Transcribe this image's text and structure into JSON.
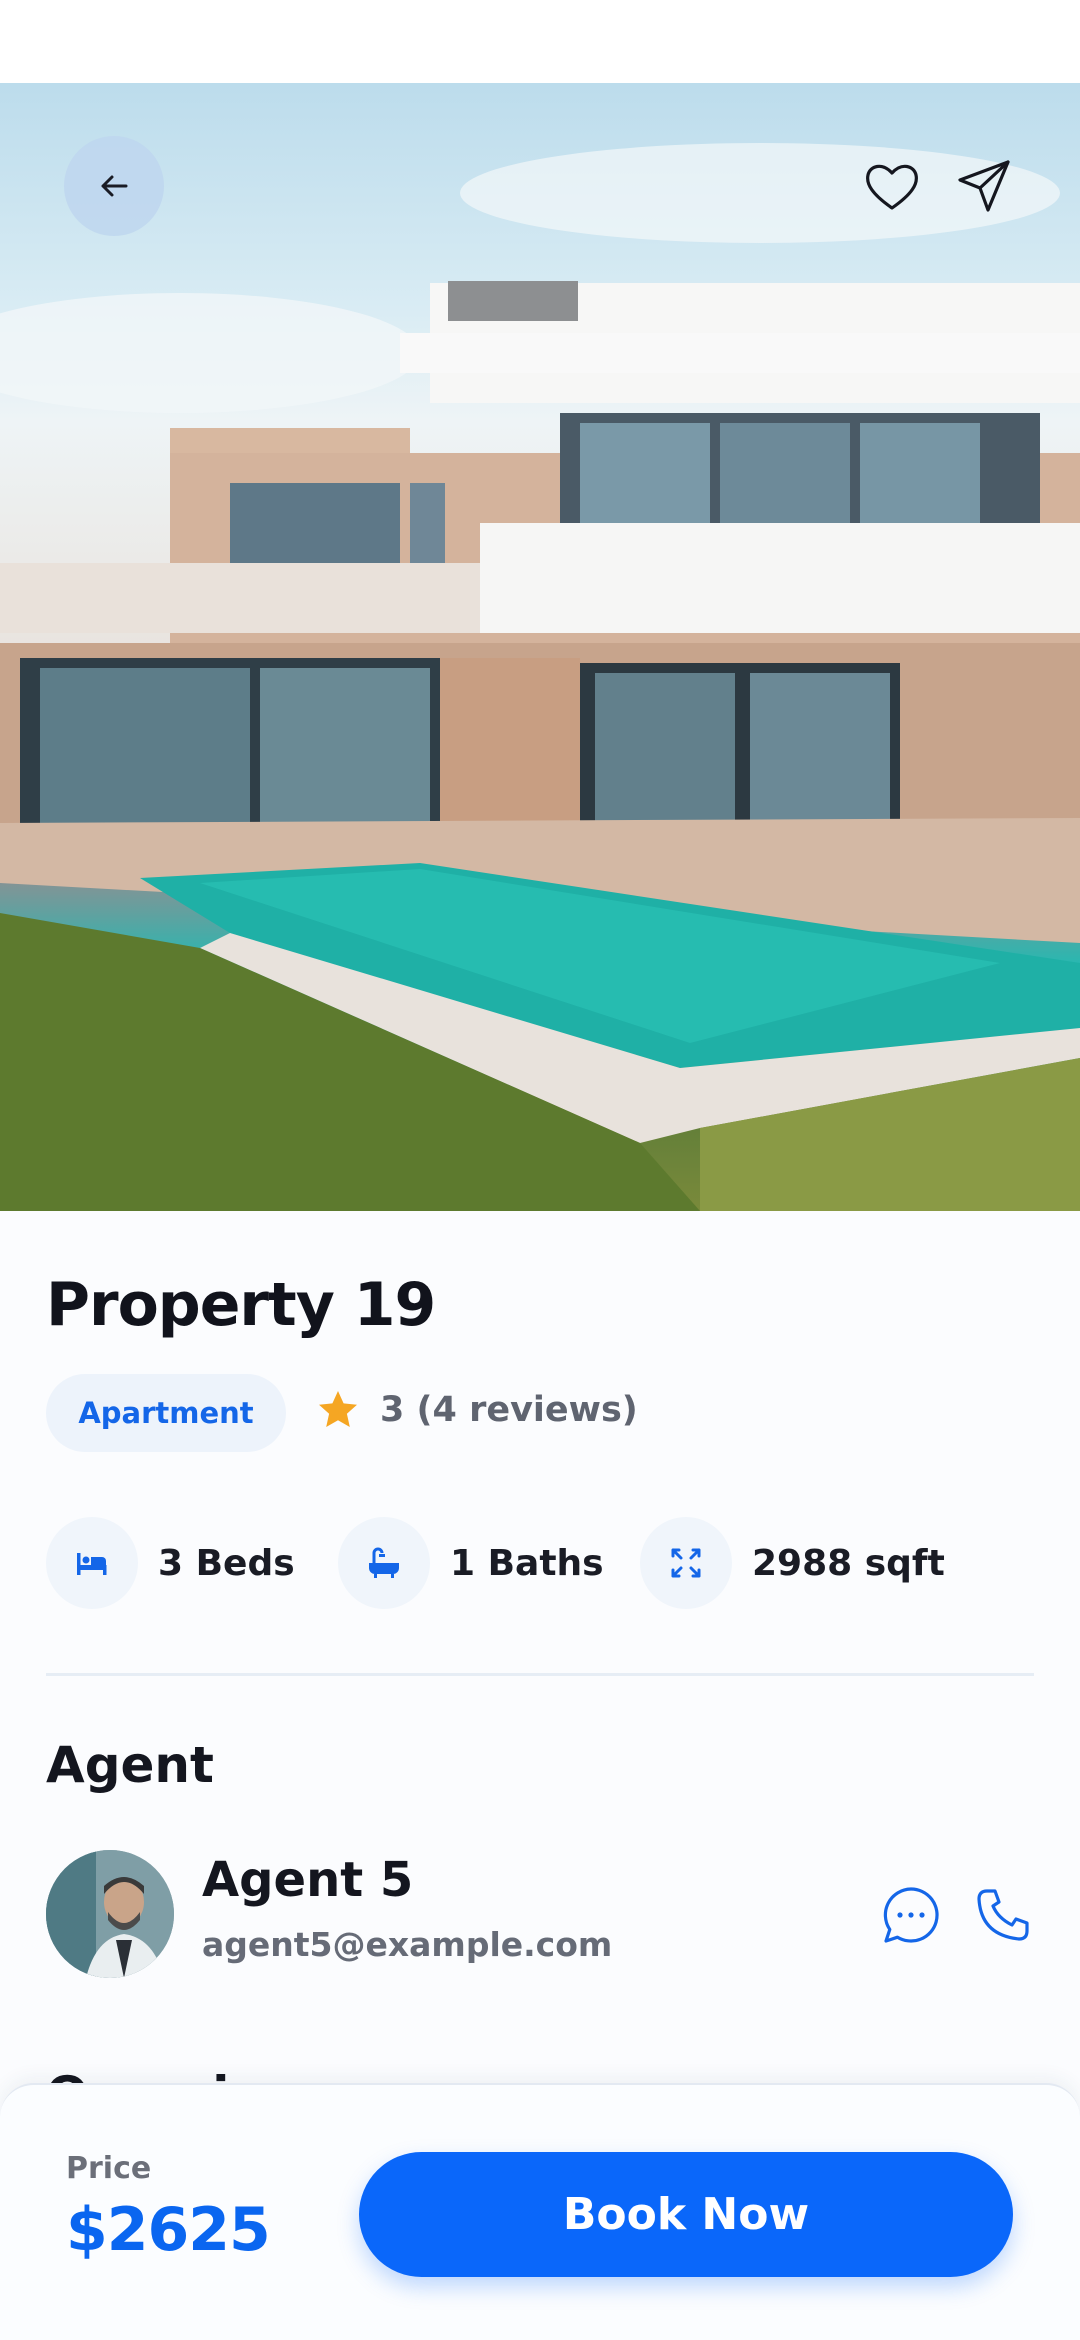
{
  "hero": {
    "back_icon": "arrow-left-icon",
    "favorite_icon": "heart-outline-icon",
    "share_icon": "send-icon"
  },
  "property": {
    "title": "Property 19",
    "type": "Apartment",
    "rating_text": "3 (4 reviews)",
    "features": {
      "beds": "3 Beds",
      "baths": "1 Baths",
      "area": "2988 sqft"
    }
  },
  "agent": {
    "section_title": "Agent",
    "name": "Agent 5",
    "email": "agent5@example.com"
  },
  "overview": {
    "section_title": "Overview"
  },
  "booking": {
    "price_label": "Price",
    "price_value": "$2625",
    "button_label": "Book Now"
  },
  "colors": {
    "accent": "#0a67fa",
    "chip_bg": "#edf3fb",
    "star": "#f5a623"
  }
}
